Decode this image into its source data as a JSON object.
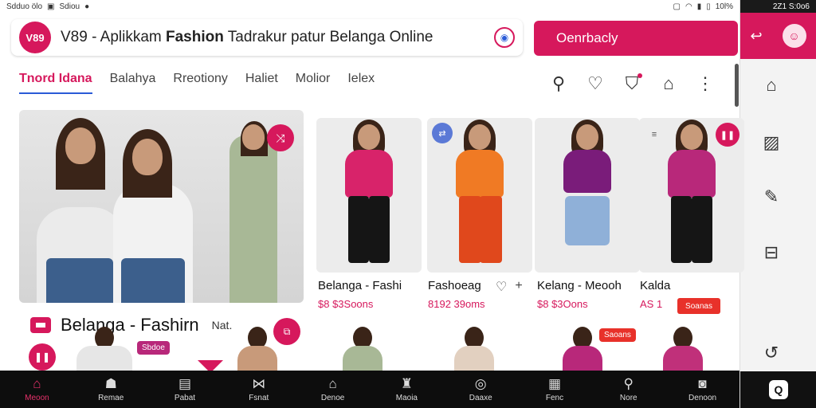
{
  "status": {
    "left": "Sdduo ölo",
    "sim": "Sdiou",
    "battery": "10l%",
    "time": "2Z1 S:0o6"
  },
  "header": {
    "logo": "V89",
    "title_prefix": "V89 - Aplikkam ",
    "title_bold": "Fashion",
    "title_suffix": " Tadrakur patur Belanga Online",
    "cta_label": "Oenrbacly"
  },
  "tabs": [
    {
      "label": "Tnord Idana",
      "active": true
    },
    {
      "label": "Balahya",
      "active": false
    },
    {
      "label": "Rreotiony",
      "active": false
    },
    {
      "label": "Haliet",
      "active": false
    },
    {
      "label": "Molior",
      "active": false
    },
    {
      "label": "Ielex",
      "active": false
    }
  ],
  "hero": {
    "title": "Belanga - Fashirn",
    "subtitle": "Nat.",
    "promo": "Sbdoe"
  },
  "products": [
    {
      "name": "Belanga - Fashi",
      "price": "$8 $3Soons",
      "top_color": "#d8236a",
      "bottom_color": "#151515"
    },
    {
      "name": "Fashoeag",
      "price": "8192 39oms",
      "top_color": "#f07a24",
      "bottom_color": "#e0481c"
    },
    {
      "name": "Kelang - Meooh",
      "price": "$8 $3Oons",
      "top_color": "#7a1c7a",
      "bottom_color": "#8fb0d8"
    },
    {
      "name": "Kalda",
      "price": "AS 1",
      "top_color": "#b8287a",
      "bottom_color": "#151515",
      "sale": "Soanas"
    }
  ],
  "promo_tag": "Saoans",
  "bottom_nav": [
    {
      "icon": "⌂",
      "label": "Meoon",
      "active": true
    },
    {
      "icon": "☗",
      "label": "Remae",
      "active": false
    },
    {
      "icon": "▤",
      "label": "Pabat",
      "active": false
    },
    {
      "icon": "⋈",
      "label": "Fsnat",
      "active": false
    },
    {
      "icon": "⌂",
      "label": "Denoe",
      "active": false
    },
    {
      "icon": "♜",
      "label": "Maoia",
      "active": false
    },
    {
      "icon": "◎",
      "label": "Daaxe",
      "active": false
    },
    {
      "icon": "▦",
      "label": "Fenc",
      "active": false
    },
    {
      "icon": "⚲",
      "label": "Nore",
      "active": false
    },
    {
      "icon": "◙",
      "label": "Denoon",
      "active": false
    }
  ],
  "colors": {
    "accent": "#d6185c",
    "nav_bg": "#0d0d0d",
    "sale": "#e8312a"
  }
}
